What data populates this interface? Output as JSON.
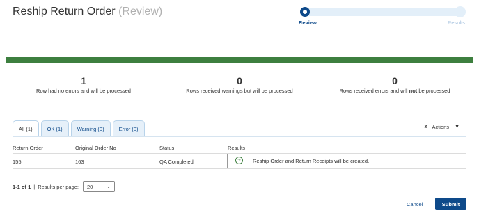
{
  "header": {
    "title": "Reship Return Order",
    "subtitle": "(Review)"
  },
  "stepper": {
    "steps": [
      "Review",
      "Results"
    ],
    "active_step": 0
  },
  "progress": {
    "fraction": 1.0,
    "color": "#3d7f3f"
  },
  "summary": [
    {
      "count": "1",
      "text": "Row had no errors and will be processed"
    },
    {
      "count": "0",
      "text": "Rows received warnings but will be processed"
    },
    {
      "count": "0",
      "text_before": "Rows received errors and will ",
      "text_bold": "not",
      "text_after": " be processed"
    }
  ],
  "tabs": [
    "All (1)",
    "OK (1)",
    "Warning (0)",
    "Error (0)"
  ],
  "actions": {
    "label": "Actions"
  },
  "table": {
    "headers": [
      "Return Order",
      "Original Order No",
      "Status",
      "Results"
    ],
    "rows": [
      {
        "return_order": "155",
        "original_order_no": "163",
        "status": "QA Completed",
        "result": "Reship Order and Return Receipts will be created.",
        "result_icon": "arrow-right-circle-icon"
      }
    ]
  },
  "pager": {
    "range": "1-1 of 1",
    "separator": "|",
    "per_page_label": "Results per page:",
    "per_page_value": "20"
  },
  "footer": {
    "cancel_label": "Cancel",
    "submit_label": "Submit"
  },
  "colors": {
    "brand": "#0e4a8a",
    "success": "#3d7f3f"
  }
}
